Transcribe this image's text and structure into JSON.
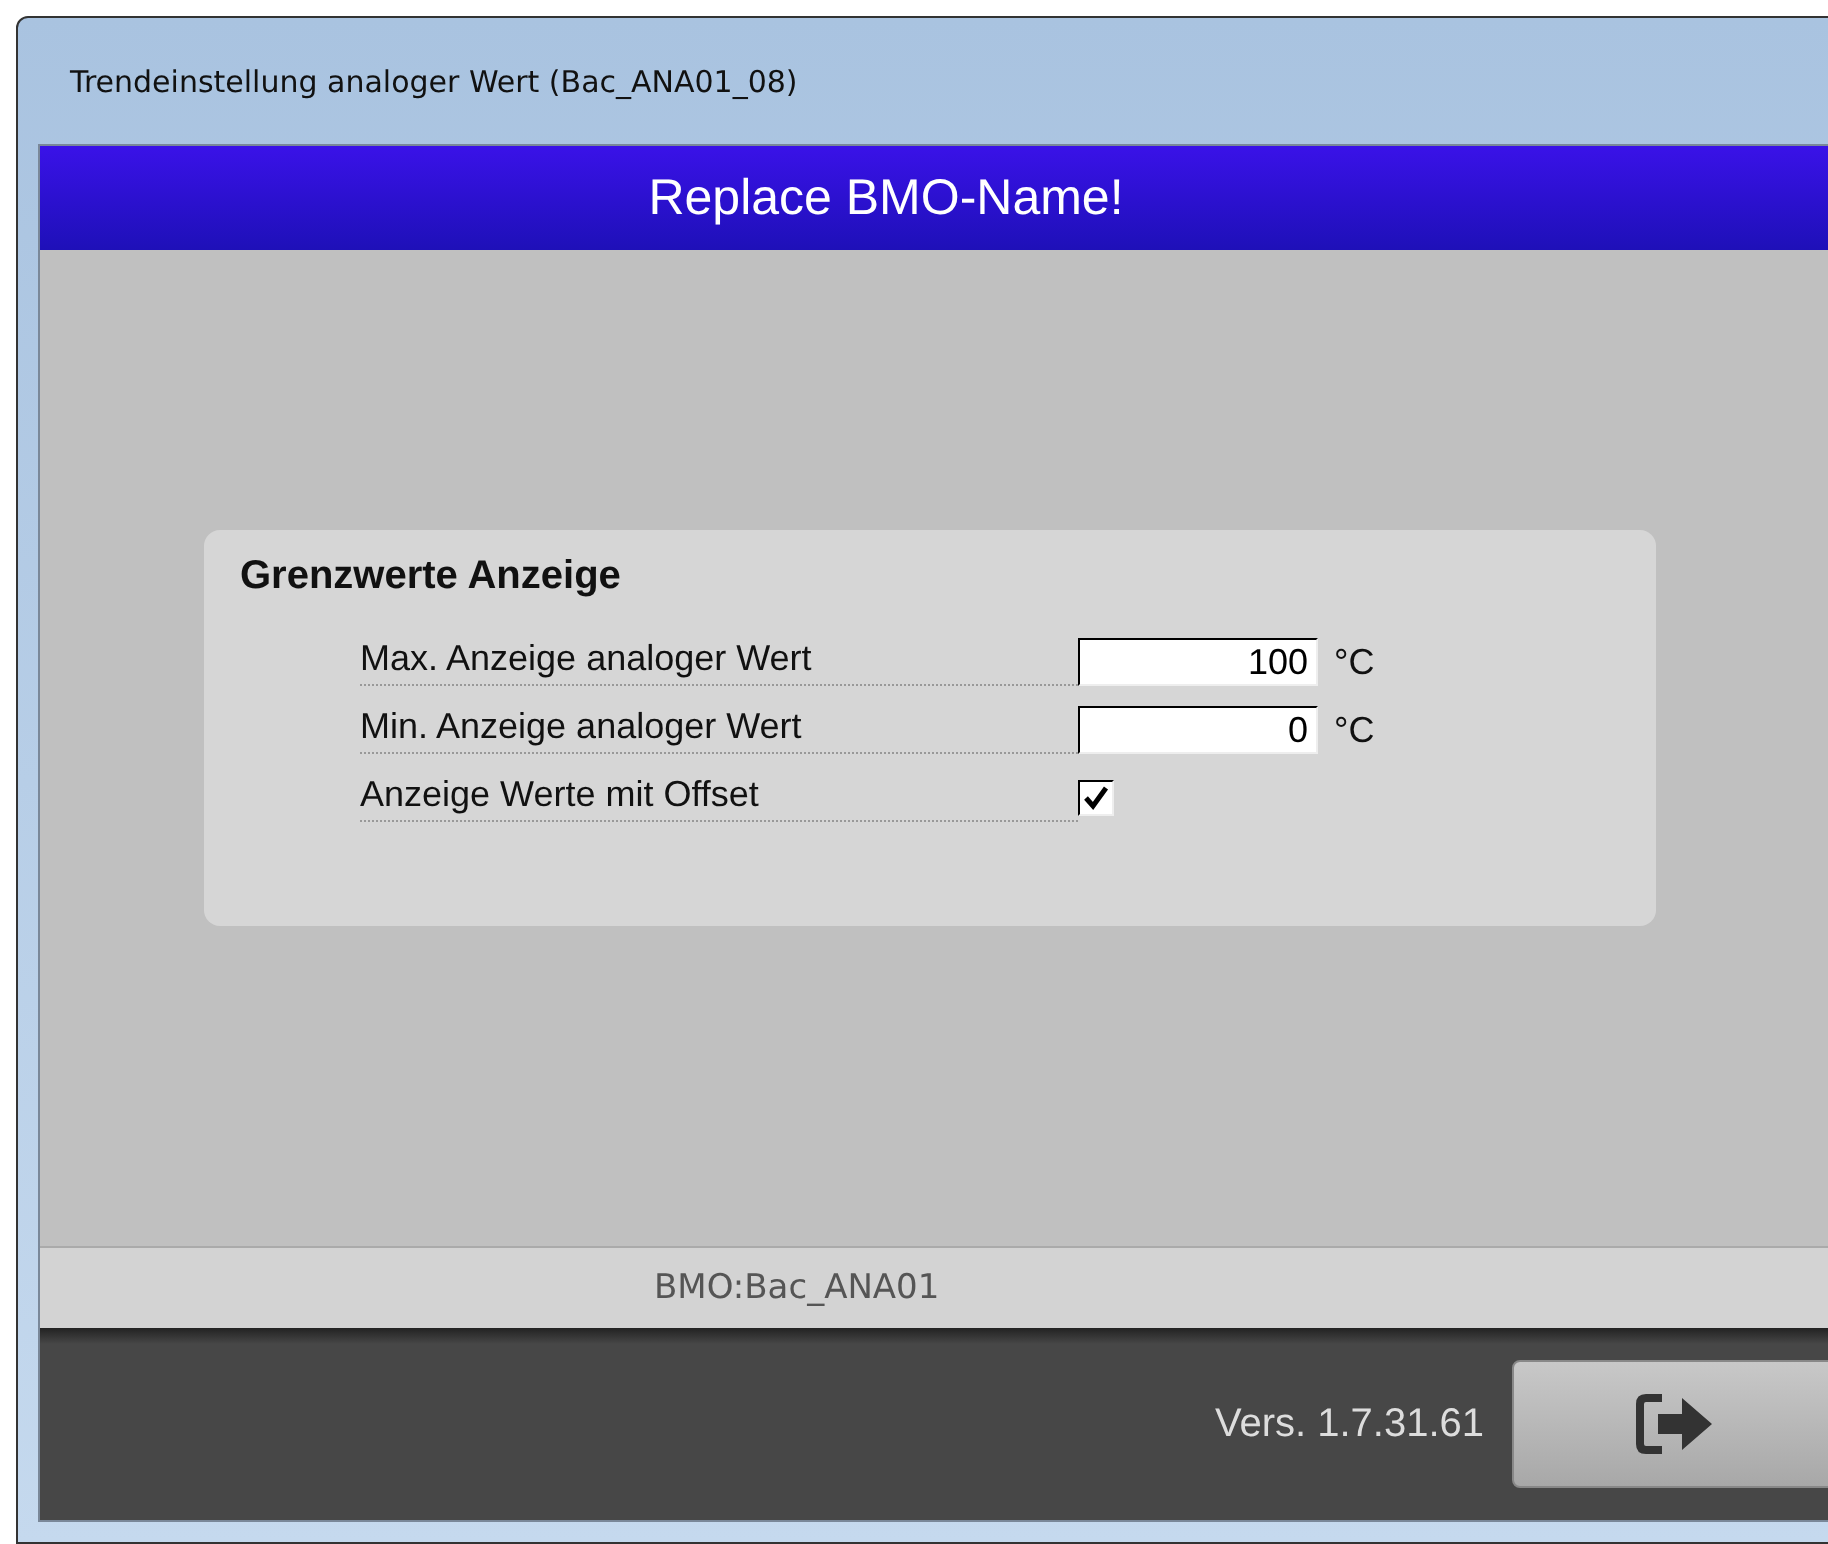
{
  "window": {
    "title": "Trendeinstellung analoger Wert (Bac_ANA01_08)"
  },
  "header": {
    "title": "Replace BMO-Name!"
  },
  "group": {
    "title": "Grenzwerte Anzeige",
    "rows": [
      {
        "kind": "number",
        "label": "Max. Anzeige analoger Wert",
        "value": "100",
        "unit": "°C"
      },
      {
        "kind": "number",
        "label": "Min. Anzeige analoger Wert",
        "value": "0",
        "unit": "°C"
      },
      {
        "kind": "checkbox",
        "label": "Anzeige Werte mit Offset",
        "checked": true
      }
    ]
  },
  "status_bar": {
    "text": "BMO:Bac_ANA01"
  },
  "footer": {
    "version": "Vers. 1.7.31.61"
  }
}
